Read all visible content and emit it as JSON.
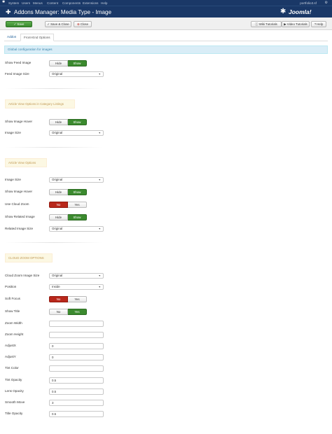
{
  "topmenu": {
    "items": [
      "System",
      "Users",
      "Menus",
      "Content",
      "Components",
      "Extensions",
      "Help"
    ],
    "site": "portfolio3.sf",
    "user_icon": "gear-icon"
  },
  "header": {
    "title": "Addons Manager: Media Type - Image",
    "brand": "Joomla!"
  },
  "toolbar": {
    "save": "Save",
    "save_close": "Save & Close",
    "close": "Close",
    "wiki": "Wiki Tutorials",
    "video": "Video Tutorials",
    "help": "Help"
  },
  "tabs": [
    "Addon",
    "Front-End Options"
  ],
  "global_info": "Global configuration for images",
  "sections": {
    "category": "Article View Options in Category Listings",
    "article": "Article View Options",
    "cloud": "CLOUD ZOOM OPTIONS"
  },
  "fields": {
    "show_feed_image": {
      "label": "Show Feed Image",
      "options": [
        "Hide",
        "Show"
      ],
      "selected": "Show"
    },
    "feed_image_size": {
      "label": "Feed Image Size",
      "value": "Original"
    },
    "show_image_hover_cat": {
      "label": "Show Image Hover",
      "options": [
        "Hide",
        "Show"
      ],
      "selected": "Show"
    },
    "image_size_cat": {
      "label": "Image Size",
      "value": "Original"
    },
    "image_size": {
      "label": "Image Size",
      "value": "Original"
    },
    "show_image_hover": {
      "label": "Show Image Hover",
      "options": [
        "Hide",
        "Show"
      ],
      "selected": "Show"
    },
    "use_cloud_zoom": {
      "label": "Use Cloud Zoom",
      "options": [
        "No",
        "Yes"
      ],
      "selected": "No"
    },
    "show_related_image": {
      "label": "Show Related Image",
      "options": [
        "Hide",
        "Show"
      ],
      "selected": "Show"
    },
    "related_image_size": {
      "label": "Related Image Size",
      "value": "Original"
    },
    "cloud_zoom_image_size": {
      "label": "Cloud Zoom Image Size",
      "value": "Original"
    },
    "position": {
      "label": "Position",
      "value": "Inside"
    },
    "soft_focus": {
      "label": "Soft Focus",
      "options": [
        "No",
        "Yes"
      ],
      "selected": "No"
    },
    "show_title": {
      "label": "Show Title",
      "options": [
        "No",
        "Yes"
      ],
      "selected": "Yes"
    },
    "zoom_width": {
      "label": "Zoom Width",
      "value": ""
    },
    "zoom_height": {
      "label": "Zoom Height",
      "value": ""
    },
    "adjust_x": {
      "label": "AdjustX",
      "value": "0"
    },
    "adjust_y": {
      "label": "AdjustY",
      "value": "0"
    },
    "tint_color": {
      "label": "Tint Color",
      "value": ""
    },
    "tint_opacity": {
      "label": "Tint Opacity",
      "value": "0.5"
    },
    "lens_opacity": {
      "label": "Lens Opacity",
      "value": "0.5"
    },
    "smooth_move": {
      "label": "Smooth Move",
      "value": "3"
    },
    "title_opacity": {
      "label": "Title Opacity",
      "value": "0.5"
    }
  }
}
